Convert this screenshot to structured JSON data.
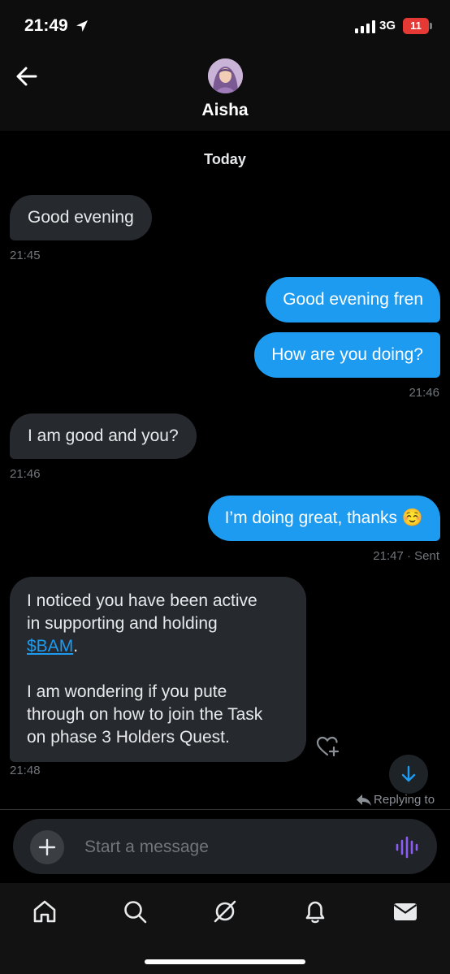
{
  "status_bar": {
    "time": "21:49",
    "network": "3G",
    "battery": "11"
  },
  "header": {
    "contact_name": "Aisha"
  },
  "conversation": {
    "day_label": "Today",
    "messages": [
      {
        "direction": "in",
        "text": "Good evening",
        "time": "21:45"
      },
      {
        "direction": "out",
        "text": "Good evening fren"
      },
      {
        "direction": "out",
        "text": "How are you doing?",
        "time": "21:46"
      },
      {
        "direction": "in",
        "text": "I am good and you?",
        "time": "21:46"
      },
      {
        "direction": "out",
        "text": "I’m doing great, thanks ☺️",
        "time": "21:47 · Sent"
      },
      {
        "direction": "in",
        "line1": "I noticed you have been active",
        "line2": "in supporting and holding",
        "link": "$BAM",
        "link_suffix": ".",
        "para2_line1": "I am wondering if you pute",
        "para2_line2": "through on how to join the Task",
        "para2_line3": "on phase 3 Holders Quest.",
        "time": "21:48"
      }
    ],
    "replying_label": "Replying to"
  },
  "composer": {
    "placeholder": "Start a message"
  },
  "colors": {
    "accent": "#1d9bf0",
    "incoming_bubble": "#26292e",
    "voice_icon": "#8b5cf6"
  },
  "icons": {
    "back": "arrow-left-icon",
    "location": "location-arrow-icon",
    "react": "heart-plus-icon",
    "scroll": "arrow-down-icon",
    "add": "plus-icon",
    "voice": "voice-wave-icon",
    "tabs": [
      "home-icon",
      "search-icon",
      "grok-icon",
      "bell-icon",
      "mail-icon"
    ]
  }
}
